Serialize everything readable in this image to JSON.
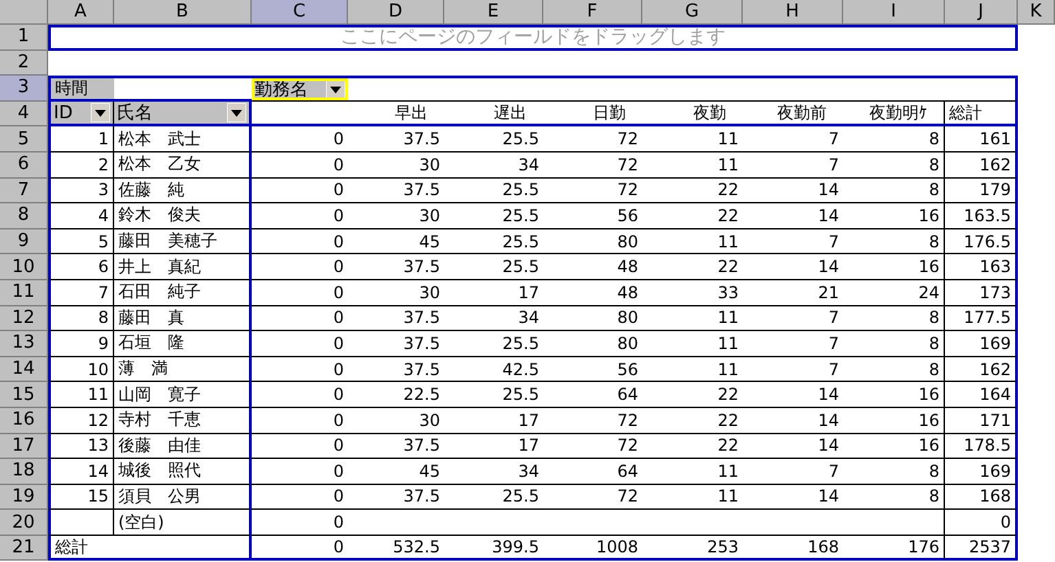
{
  "column_headers": [
    {
      "label": "A",
      "selected": false
    },
    {
      "label": "B",
      "selected": false
    },
    {
      "label": "C",
      "selected": true
    },
    {
      "label": "D",
      "selected": false
    },
    {
      "label": "E",
      "selected": false
    },
    {
      "label": "F",
      "selected": false
    },
    {
      "label": "G",
      "selected": false
    },
    {
      "label": "H",
      "selected": false
    },
    {
      "label": "I",
      "selected": false
    },
    {
      "label": "J",
      "selected": false
    },
    {
      "label": "K",
      "selected": false
    }
  ],
  "row_headers": [
    {
      "label": "1",
      "selected": false
    },
    {
      "label": "2",
      "selected": false
    },
    {
      "label": "3",
      "selected": true
    },
    {
      "label": "4",
      "selected": false
    },
    {
      "label": "5",
      "selected": false
    },
    {
      "label": "6",
      "selected": false
    },
    {
      "label": "7",
      "selected": false
    },
    {
      "label": "8",
      "selected": false
    },
    {
      "label": "9",
      "selected": false
    },
    {
      "label": "10",
      "selected": false
    },
    {
      "label": "11",
      "selected": false
    },
    {
      "label": "12",
      "selected": false
    },
    {
      "label": "13",
      "selected": false
    },
    {
      "label": "14",
      "selected": false
    },
    {
      "label": "15",
      "selected": false
    },
    {
      "label": "16",
      "selected": false
    },
    {
      "label": "17",
      "selected": false
    },
    {
      "label": "18",
      "selected": false
    },
    {
      "label": "19",
      "selected": false
    },
    {
      "label": "20",
      "selected": false
    },
    {
      "label": "21",
      "selected": false
    }
  ],
  "page_area": {
    "placeholder": "ここにページのフィールドをドラッグします"
  },
  "data_field": "時間",
  "column_field": {
    "label": "勤務名",
    "selected": true
  },
  "row_fields": [
    {
      "label": "ID"
    },
    {
      "label": "氏名"
    }
  ],
  "column_items": [
    "早出",
    "遅出",
    "日勤",
    "夜勤",
    "夜勤前",
    "夜勤明ｹ",
    "総計"
  ],
  "rows": [
    {
      "id": "1",
      "name": "松本　武士",
      "values": [
        "0",
        "37.5",
        "25.5",
        "72",
        "11",
        "7",
        "8",
        "161"
      ]
    },
    {
      "id": "2",
      "name": "松本　乙女",
      "values": [
        "0",
        "30",
        "34",
        "72",
        "11",
        "7",
        "8",
        "162"
      ]
    },
    {
      "id": "3",
      "name": "佐藤　純",
      "values": [
        "0",
        "37.5",
        "25.5",
        "72",
        "22",
        "14",
        "8",
        "179"
      ]
    },
    {
      "id": "4",
      "name": "鈴木　俊夫",
      "values": [
        "0",
        "30",
        "25.5",
        "56",
        "22",
        "14",
        "16",
        "163.5"
      ]
    },
    {
      "id": "5",
      "name": "藤田　美穂子",
      "values": [
        "0",
        "45",
        "25.5",
        "80",
        "11",
        "7",
        "8",
        "176.5"
      ]
    },
    {
      "id": "6",
      "name": "井上　真紀",
      "values": [
        "0",
        "37.5",
        "25.5",
        "48",
        "22",
        "14",
        "16",
        "163"
      ]
    },
    {
      "id": "7",
      "name": "石田　純子",
      "values": [
        "0",
        "30",
        "17",
        "48",
        "33",
        "21",
        "24",
        "173"
      ]
    },
    {
      "id": "8",
      "name": "藤田　真",
      "values": [
        "0",
        "37.5",
        "34",
        "80",
        "11",
        "7",
        "8",
        "177.5"
      ]
    },
    {
      "id": "9",
      "name": "石垣　隆",
      "values": [
        "0",
        "37.5",
        "25.5",
        "80",
        "11",
        "7",
        "8",
        "169"
      ]
    },
    {
      "id": "10",
      "name": "薄　満",
      "values": [
        "0",
        "37.5",
        "42.5",
        "56",
        "11",
        "7",
        "8",
        "162"
      ]
    },
    {
      "id": "11",
      "name": "山岡　寛子",
      "values": [
        "0",
        "22.5",
        "25.5",
        "64",
        "22",
        "14",
        "16",
        "164"
      ]
    },
    {
      "id": "12",
      "name": "寺村　千恵",
      "values": [
        "0",
        "30",
        "17",
        "72",
        "22",
        "14",
        "16",
        "171"
      ]
    },
    {
      "id": "13",
      "name": "後藤　由佳",
      "values": [
        "0",
        "37.5",
        "17",
        "72",
        "22",
        "14",
        "16",
        "178.5"
      ]
    },
    {
      "id": "14",
      "name": "城後　照代",
      "values": [
        "0",
        "45",
        "34",
        "64",
        "11",
        "7",
        "8",
        "169"
      ]
    },
    {
      "id": "15",
      "name": "須貝　公男",
      "values": [
        "0",
        "37.5",
        "25.5",
        "72",
        "11",
        "14",
        "8",
        "168"
      ]
    },
    {
      "name": "(空白)",
      "values": [
        "0"
      ],
      "total": "0"
    }
  ],
  "grand_total": {
    "label": "総計",
    "values": [
      "0",
      "532.5",
      "399.5",
      "1008",
      "253",
      "168",
      "176",
      "2537"
    ]
  }
}
